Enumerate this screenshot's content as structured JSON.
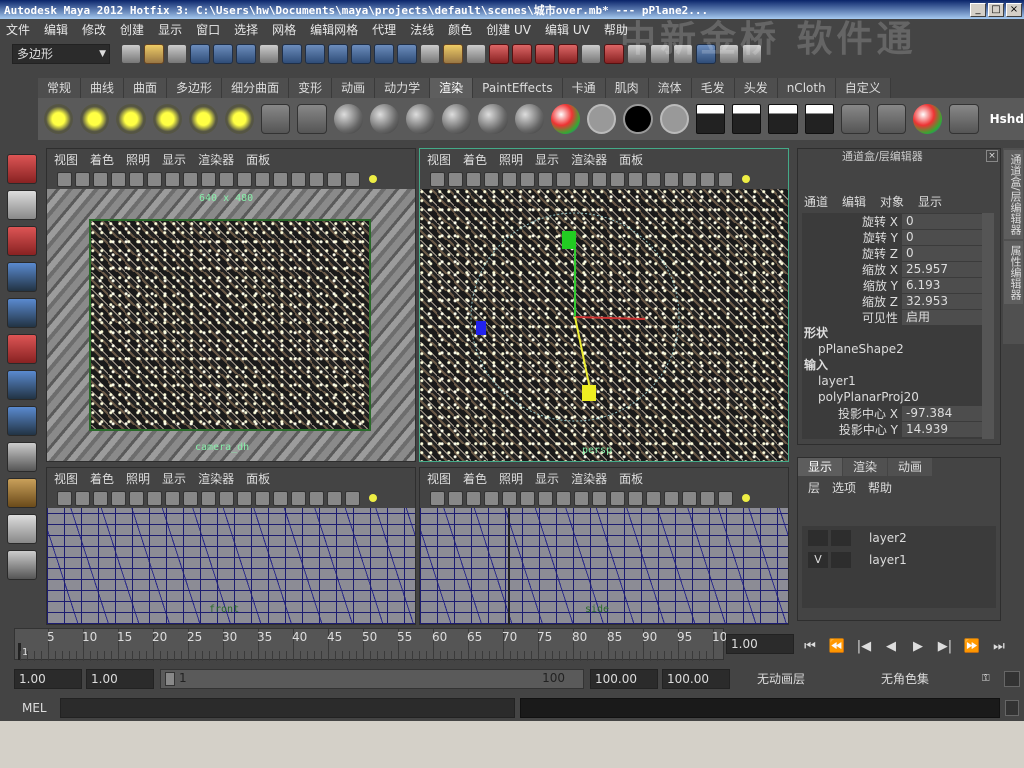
{
  "window": {
    "title": "Autodesk Maya 2012 Hotfix 3: C:\\Users\\hw\\Documents\\maya\\projects\\default\\scenes\\城市over.mb*   ---   pPlane2...",
    "watermark": "中新金桥 软件通"
  },
  "menubar": [
    "文件",
    "编辑",
    "修改",
    "创建",
    "显示",
    "窗口",
    "选择",
    "网格",
    "编辑网格",
    "代理",
    "法线",
    "颜色",
    "创建 UV",
    "编辑 UV",
    "帮助"
  ],
  "statusline": {
    "mode": "多边形"
  },
  "shelf": {
    "tabs": [
      "常规",
      "曲线",
      "曲面",
      "多边形",
      "细分曲面",
      "变形",
      "动画",
      "动力学",
      "渲染",
      "PaintEffects",
      "卡通",
      "肌肉",
      "流体",
      "毛发",
      "头发",
      "nCloth",
      "自定义"
    ],
    "active_tab": "渲染",
    "last_label": "Hshd"
  },
  "viewport_menu": [
    "视图",
    "着色",
    "照明",
    "显示",
    "渲染器",
    "面板"
  ],
  "viewports": {
    "top_left": {
      "resolution": "640 x 480",
      "camera": "camera_dh"
    },
    "top_right": {
      "camera": "persp"
    },
    "bottom_left": {
      "camera": "front"
    },
    "bottom_right": {
      "camera": "side"
    }
  },
  "channel_box": {
    "title": "通道盒/层编辑器",
    "menu": [
      "通道",
      "编辑",
      "对象",
      "显示"
    ],
    "attributes": [
      {
        "name": "旋转 X",
        "value": "0"
      },
      {
        "name": "旋转 Y",
        "value": "0"
      },
      {
        "name": "旋转 Z",
        "value": "0"
      },
      {
        "name": "缩放 X",
        "value": "25.957"
      },
      {
        "name": "缩放 Y",
        "value": "6.193"
      },
      {
        "name": "缩放 Z",
        "value": "32.953"
      },
      {
        "name": "可见性",
        "value": "启用"
      }
    ],
    "shape_header": "形状",
    "shape_name": "pPlaneShape2",
    "inputs_header": "输入",
    "inputs": [
      "layer1",
      "polyPlanarProj20"
    ],
    "proj_attributes": [
      {
        "name": "投影中心 X",
        "value": "-97.384"
      },
      {
        "name": "投影中心 Y",
        "value": "14.939"
      }
    ]
  },
  "side_tabs": [
    "通道盒/层编辑器",
    "属性编辑器"
  ],
  "layer_editor": {
    "tabs": [
      "显示",
      "渲染",
      "动画"
    ],
    "active_tab": "显示",
    "menu": [
      "层",
      "选项",
      "帮助"
    ],
    "layers": [
      {
        "visible": "",
        "name": "layer2"
      },
      {
        "visible": "V",
        "name": "layer1"
      }
    ]
  },
  "timeline": {
    "ticks": [
      "5",
      "10",
      "15",
      "20",
      "25",
      "30",
      "35",
      "40",
      "45",
      "50",
      "55",
      "60",
      "65",
      "70",
      "75",
      "80",
      "85",
      "90",
      "95",
      "10"
    ],
    "current_frame": "1",
    "current_frame_field": "1.00",
    "play_controls": [
      "⏮",
      "⏪",
      "|◀",
      "◀",
      "▶",
      "▶|",
      "⏩",
      "⏭"
    ]
  },
  "range": {
    "start_time": "1.00",
    "start_range": "1.00",
    "range_start": "1",
    "range_end": "100",
    "end_range": "100.00",
    "end_time": "100.00",
    "anim_layer": "无动画层",
    "char_set": "无角色集"
  },
  "command_line": {
    "label": "MEL"
  }
}
